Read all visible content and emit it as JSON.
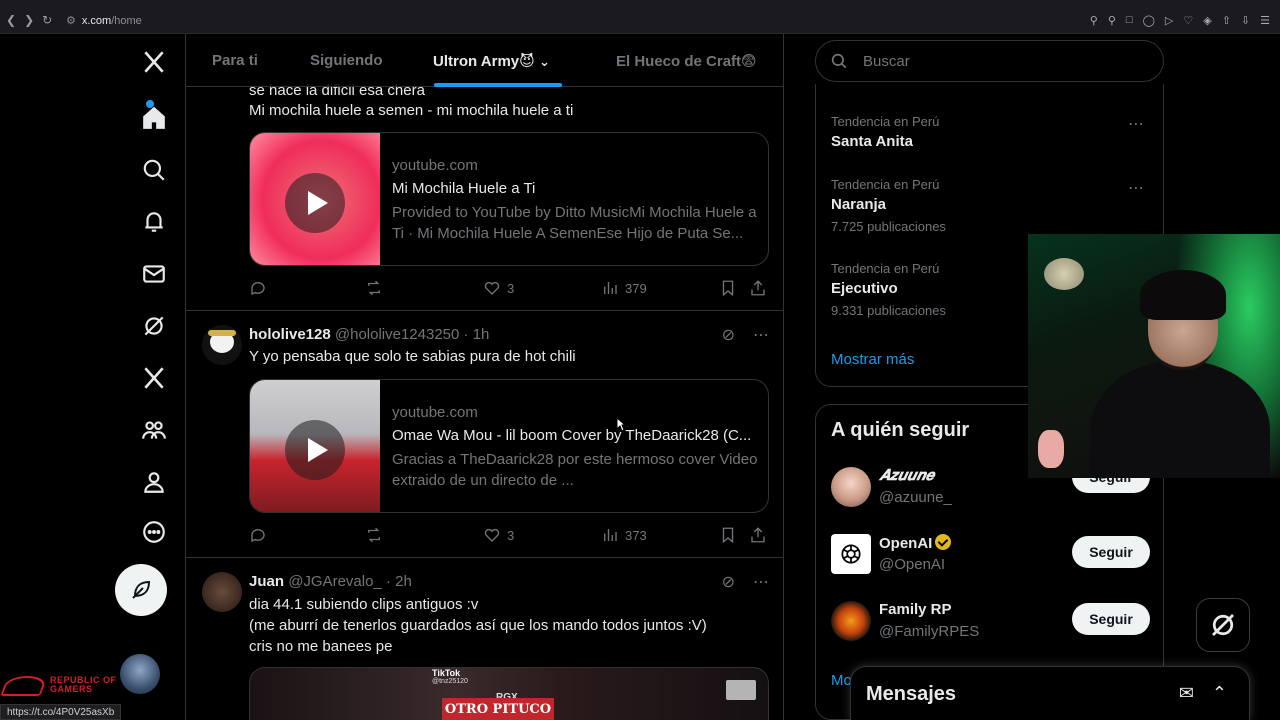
{
  "browser": {
    "url_host": "x.com",
    "url_path": "/home",
    "status_url": "https://t.co/4P0V25asXb"
  },
  "timeline_tabs": [
    {
      "label": "Para ti"
    },
    {
      "label": "Siguiendo"
    },
    {
      "label": "Ultron Army😈"
    },
    {
      "label": "El Hueco de Craft😨"
    }
  ],
  "tweets": [
    {
      "text_lines": [
        "se hace la dificil esa chera",
        "Mi mochila huele a semen - mi mochila huele a ti"
      ],
      "card": {
        "domain": "youtube.com",
        "title": "Mi Mochila Huele a Ti",
        "description": "Provided to YouTube by Ditto MusicMi Mochila Huele a Ti · Mi Mochila Huele A SemenEse Hijo de Puta Se..."
      },
      "likes": "3",
      "views": "379"
    },
    {
      "name": "hololive128",
      "handle": "@hololive1243250",
      "time": "· 1h",
      "text": "Y yo pensaba que solo te sabias pura de hot chili",
      "card": {
        "domain": "youtube.com",
        "title": "Omae Wa Mou - lil boom Cover by TheDaarick28 (C...",
        "description": "Gracias a TheDaarick28 por este hermoso cover Video extraido de un directo de ..."
      },
      "likes": "3",
      "views": "373"
    },
    {
      "name": "Juan",
      "handle": "@JGArevalo_",
      "time": "· 2h",
      "text_lines": [
        "dia 44.1 subiendo clips antiguos :v",
        "(me aburrí de tenerlos guardados así que los mando todos juntos :V)",
        "cris no me banees pe"
      ],
      "media_texts": [
        "TikTok",
        "@tnz25120",
        "RGX",
        "OTRO PITUCO"
      ]
    }
  ],
  "search": {
    "placeholder": "Buscar"
  },
  "trends": [
    {
      "context": "Tendencia en Perú",
      "name": "Santa Anita",
      "posts": ""
    },
    {
      "context": "Tendencia en Perú",
      "name": "Naranja",
      "posts": "7.725 publicaciones"
    },
    {
      "context": "Tendencia en Perú",
      "name": "Ejecutivo",
      "posts": "9.331 publicaciones"
    }
  ],
  "show_more": "Mostrar más",
  "follow": {
    "title": "A quién seguir",
    "users": [
      {
        "name": "𝑨𝒛𝒖𝒖𝒏𝒆",
        "handle": "@azuune_",
        "button": "Seguir"
      },
      {
        "name": "OpenAI",
        "handle": "@OpenAI",
        "button": "Seguir",
        "verified": true
      },
      {
        "name": "Family RP",
        "handle": "@FamilyRPES",
        "button": "Seguir"
      }
    ],
    "more_partial": "Mo"
  },
  "messages": {
    "title": "Mensajes"
  },
  "overlay": {
    "rog_text": "REPUBLIC OF GAMERS"
  },
  "colors": {
    "accent": "#1d9bf0",
    "bg": "#000000",
    "muted": "#71767b",
    "text": "#e7e9ea",
    "rog_red": "#d21f26"
  }
}
